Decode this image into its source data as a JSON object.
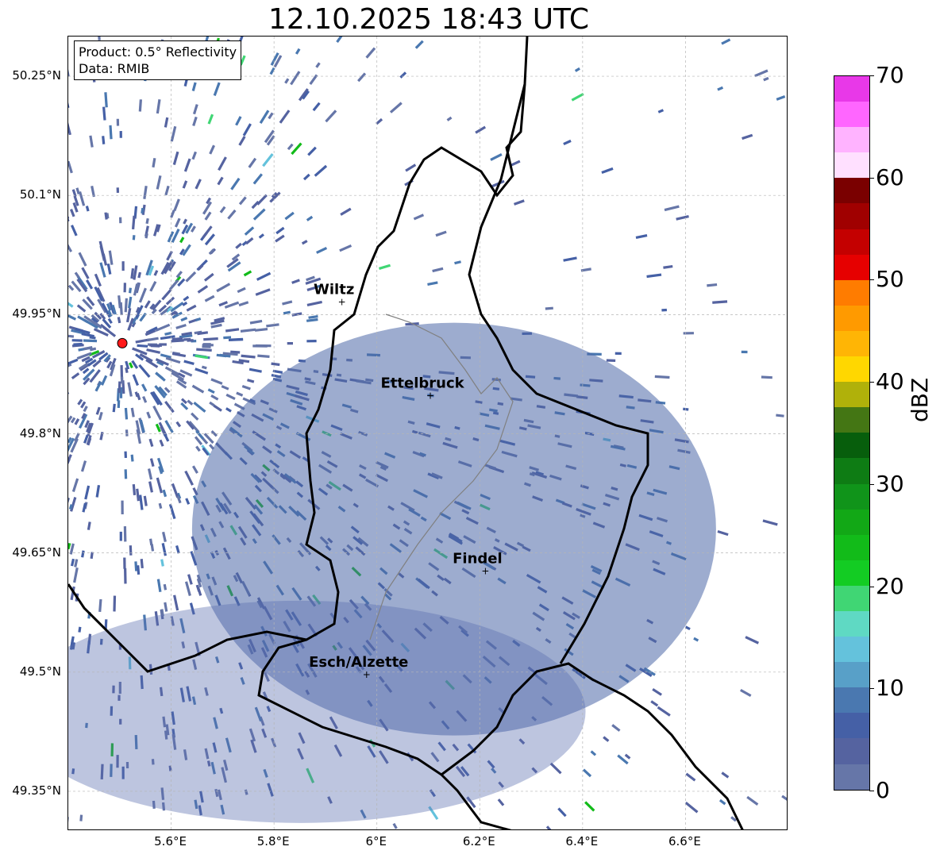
{
  "title": "12.10.2025 18:43 UTC",
  "info_box": {
    "product": "Product: 0.5° Reflectivity",
    "source": "Data: RMIB"
  },
  "map": {
    "lon_range": [
      5.4,
      6.8
    ],
    "lat_range": [
      49.3,
      50.3
    ],
    "grid": true,
    "lat_ticks": [
      {
        "value": 50.25,
        "label": "50.25°N"
      },
      {
        "value": 50.1,
        "label": "50.1°N"
      },
      {
        "value": 49.95,
        "label": "49.95°N"
      },
      {
        "value": 49.8,
        "label": "49.8°N"
      },
      {
        "value": 49.65,
        "label": "49.65°N"
      },
      {
        "value": 49.5,
        "label": "49.5°N"
      },
      {
        "value": 49.35,
        "label": "49.35°N"
      }
    ],
    "lon_ticks": [
      {
        "value": 5.6,
        "label": "5.6°E"
      },
      {
        "value": 5.8,
        "label": "5.8°E"
      },
      {
        "value": 6.0,
        "label": "6°E"
      },
      {
        "value": 6.2,
        "label": "6.2°E"
      },
      {
        "value": 6.4,
        "label": "6.4°E"
      },
      {
        "value": 6.6,
        "label": "6.6°E"
      }
    ],
    "radar_site": {
      "lon": 5.505,
      "lat": 49.914,
      "color": "#ff1a1a"
    },
    "cities": [
      {
        "name": "Wiltz",
        "lon": 5.932,
        "lat": 49.966
      },
      {
        "name": "Ettelbruck",
        "lon": 6.104,
        "lat": 49.848
      },
      {
        "name": "Findel",
        "lon": 6.211,
        "lat": 49.627
      },
      {
        "name": "Esch/Alzette",
        "lon": 5.98,
        "lat": 49.497
      }
    ]
  },
  "colorbar": {
    "label": "dBZ",
    "min": 0,
    "max": 70,
    "ticks": [
      "0",
      "10",
      "20",
      "30",
      "40",
      "50",
      "60",
      "70"
    ],
    "colors": [
      "#6676a8",
      "#5563a0",
      "#4560a6",
      "#4a78b0",
      "#58a0c8",
      "#64c2dc",
      "#5fd9c3",
      "#40d674",
      "#13cc23",
      "#12bb19",
      "#12a816",
      "#10941a",
      "#0e7c14",
      "#075e0c",
      "#447614",
      "#b0b10a",
      "#ffd700",
      "#ffb505",
      "#ff9a00",
      "#ff7c00",
      "#e60000",
      "#c40000",
      "#a00000",
      "#7a0000",
      "#ffe0ff",
      "#ffb3ff",
      "#ff66ff",
      "#e838e8"
    ]
  }
}
